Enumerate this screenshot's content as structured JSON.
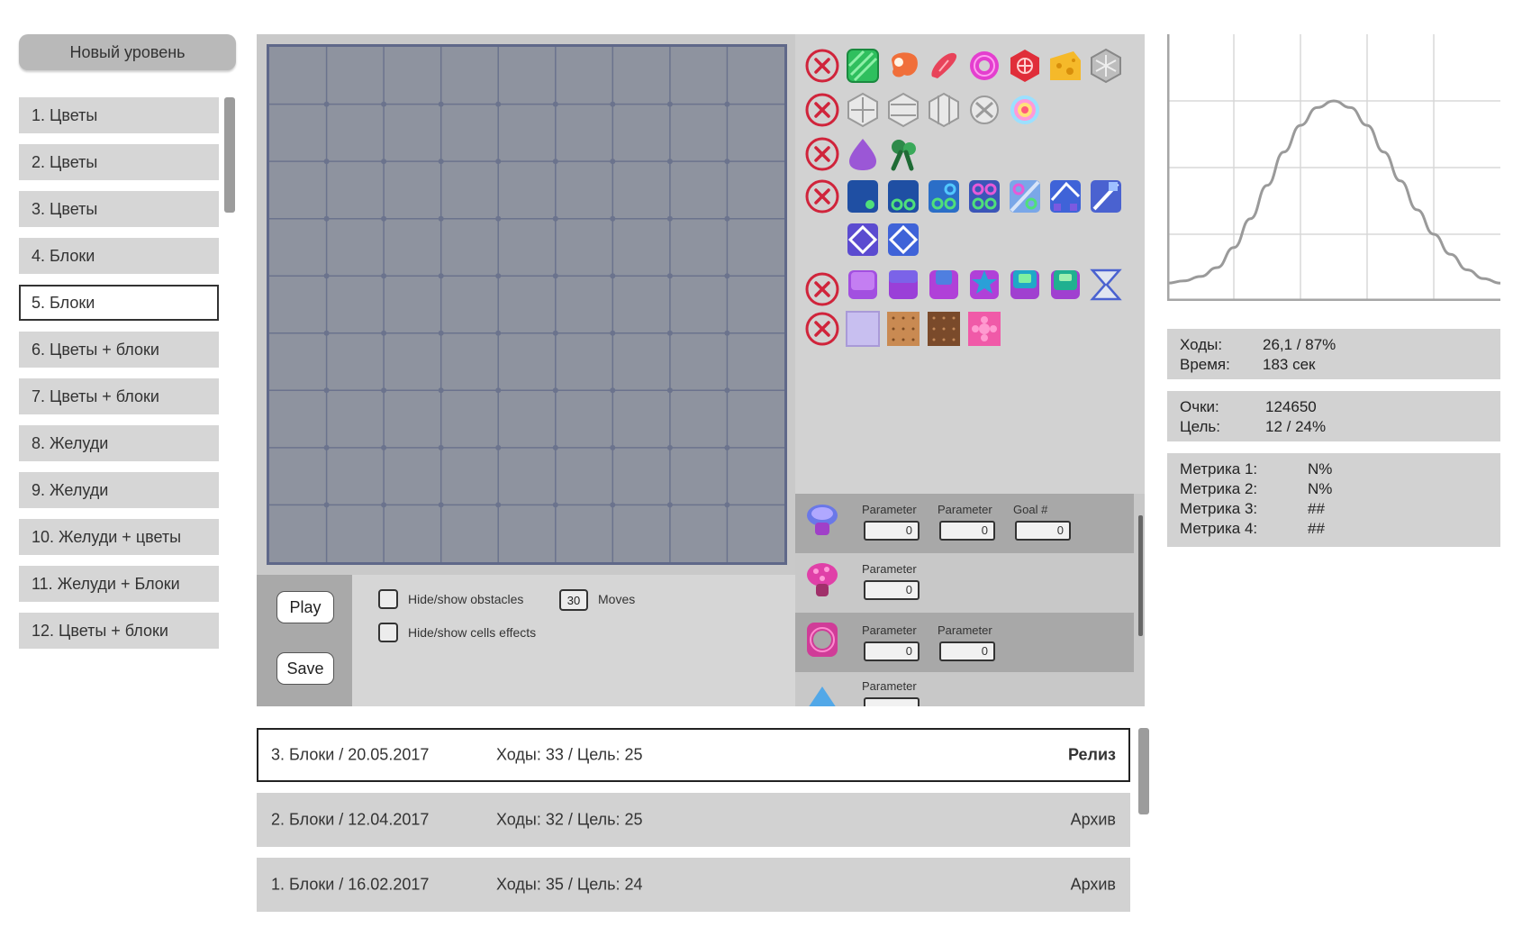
{
  "sidebar": {
    "new_level_label": "Новый уровень",
    "levels": [
      {
        "label": "1. Цветы"
      },
      {
        "label": "2. Цветы"
      },
      {
        "label": "3. Цветы"
      },
      {
        "label": "4. Блоки"
      },
      {
        "label": "5. Блоки",
        "selected": true
      },
      {
        "label": "6. Цветы + блоки"
      },
      {
        "label": "7. Цветы + блоки"
      },
      {
        "label": "8. Желуди"
      },
      {
        "label": "9. Желуди"
      },
      {
        "label": "10. Желуди + цветы"
      },
      {
        "label": "11. Желуди + Блоки"
      },
      {
        "label": "12. Цветы + блоки"
      }
    ]
  },
  "board": {
    "rows": 9,
    "cols": 9
  },
  "controls": {
    "play_label": "Play",
    "save_label": "Save",
    "hide_obstacles_label": "Hide/show obstacles",
    "hide_effects_label": "Hide/show cells effects",
    "moves_value": "30",
    "moves_label": "Moves"
  },
  "palette_icons": {
    "row1": [
      "green-striped-tile-icon",
      "meat-icon",
      "sausage-icon",
      "donut-icon",
      "red-hexagon-icon",
      "cheese-icon",
      "gray-hexagon-icon"
    ],
    "row2": [
      "white-blocker-icon-1",
      "white-blocker-icon-2",
      "white-blocker-icon-3",
      "white-gear-icon",
      "rainbow-ball-icon"
    ],
    "row3": [
      "purple-drop-icon",
      "green-broccoli-icon"
    ],
    "row4": [
      "blue-block-icon",
      "blue-block-rings-icon",
      "blue-rings-icon",
      "purple-rings-icon",
      "glass-rings-icon",
      "blue-diagonal-tile-icon",
      "blue-diamond-tile-icon",
      "purple-diamond-tile-icon",
      "blue-diamond-tile-icon-2"
    ],
    "row5": [
      "purple-cube-icon",
      "violet-cube-icon",
      "magenta-cube-icon",
      "blue-star-cube-icon",
      "teal-cube-icon",
      "green-cube-icon",
      "hourglass-icon"
    ],
    "row6": [
      "lavender-cell-icon",
      "cookie-cell-icon",
      "chocolate-cell-icon",
      "pink-flower-cell-icon"
    ]
  },
  "params": {
    "row1": [
      {
        "label": "Parameter",
        "value": "0"
      },
      {
        "label": "Parameter",
        "value": "0"
      },
      {
        "label": "Goal #",
        "value": "0"
      }
    ],
    "row2": [
      {
        "label": "Parameter",
        "value": "0"
      }
    ],
    "row3": [
      {
        "label": "Parameter",
        "value": "0"
      },
      {
        "label": "Parameter",
        "value": "0"
      }
    ],
    "row4": [
      {
        "label": "Parameter",
        "value": ""
      }
    ]
  },
  "history": [
    {
      "name": "3. Блоки / 20.05.2017",
      "stats": "Ходы: 33 / Цель: 25",
      "status": "Релиз",
      "current": true
    },
    {
      "name": "2. Блоки / 12.04.2017",
      "stats": "Ходы: 32 / Цель: 25",
      "status": "Архив"
    },
    {
      "name": "1. Блоки / 16.02.2017",
      "stats": "Ходы: 35 / Цель: 24",
      "status": "Архив"
    }
  ],
  "stats": {
    "moves_label": "Ходы:",
    "moves_value": "26,1 / 87%",
    "time_label": "Время:",
    "time_value": "183 сек",
    "score_label": "Очки:",
    "score_value": "124650",
    "goal_label": "Цель:",
    "goal_value": "12 / 24%",
    "metrics": [
      {
        "label": "Метрика 1:",
        "value": "N%"
      },
      {
        "label": "Метрика 2:",
        "value": "N%"
      },
      {
        "label": "Метрика 3:",
        "value": "##"
      },
      {
        "label": "Метрика 4:",
        "value": "##"
      }
    ]
  },
  "chart_data": {
    "type": "line",
    "title": "",
    "xlabel": "",
    "ylabel": "",
    "grid": true,
    "x": [
      0,
      1,
      2,
      3,
      4,
      5,
      6,
      7,
      8,
      9,
      10,
      11,
      12,
      13,
      14,
      15,
      16,
      17,
      18,
      19,
      20
    ],
    "y": [
      0.08,
      0.09,
      0.11,
      0.15,
      0.24,
      0.37,
      0.52,
      0.67,
      0.79,
      0.87,
      0.9,
      0.87,
      0.79,
      0.67,
      0.54,
      0.41,
      0.3,
      0.21,
      0.14,
      0.1,
      0.08
    ],
    "xlim": [
      0,
      20
    ],
    "ylim": [
      0,
      1.2
    ]
  }
}
